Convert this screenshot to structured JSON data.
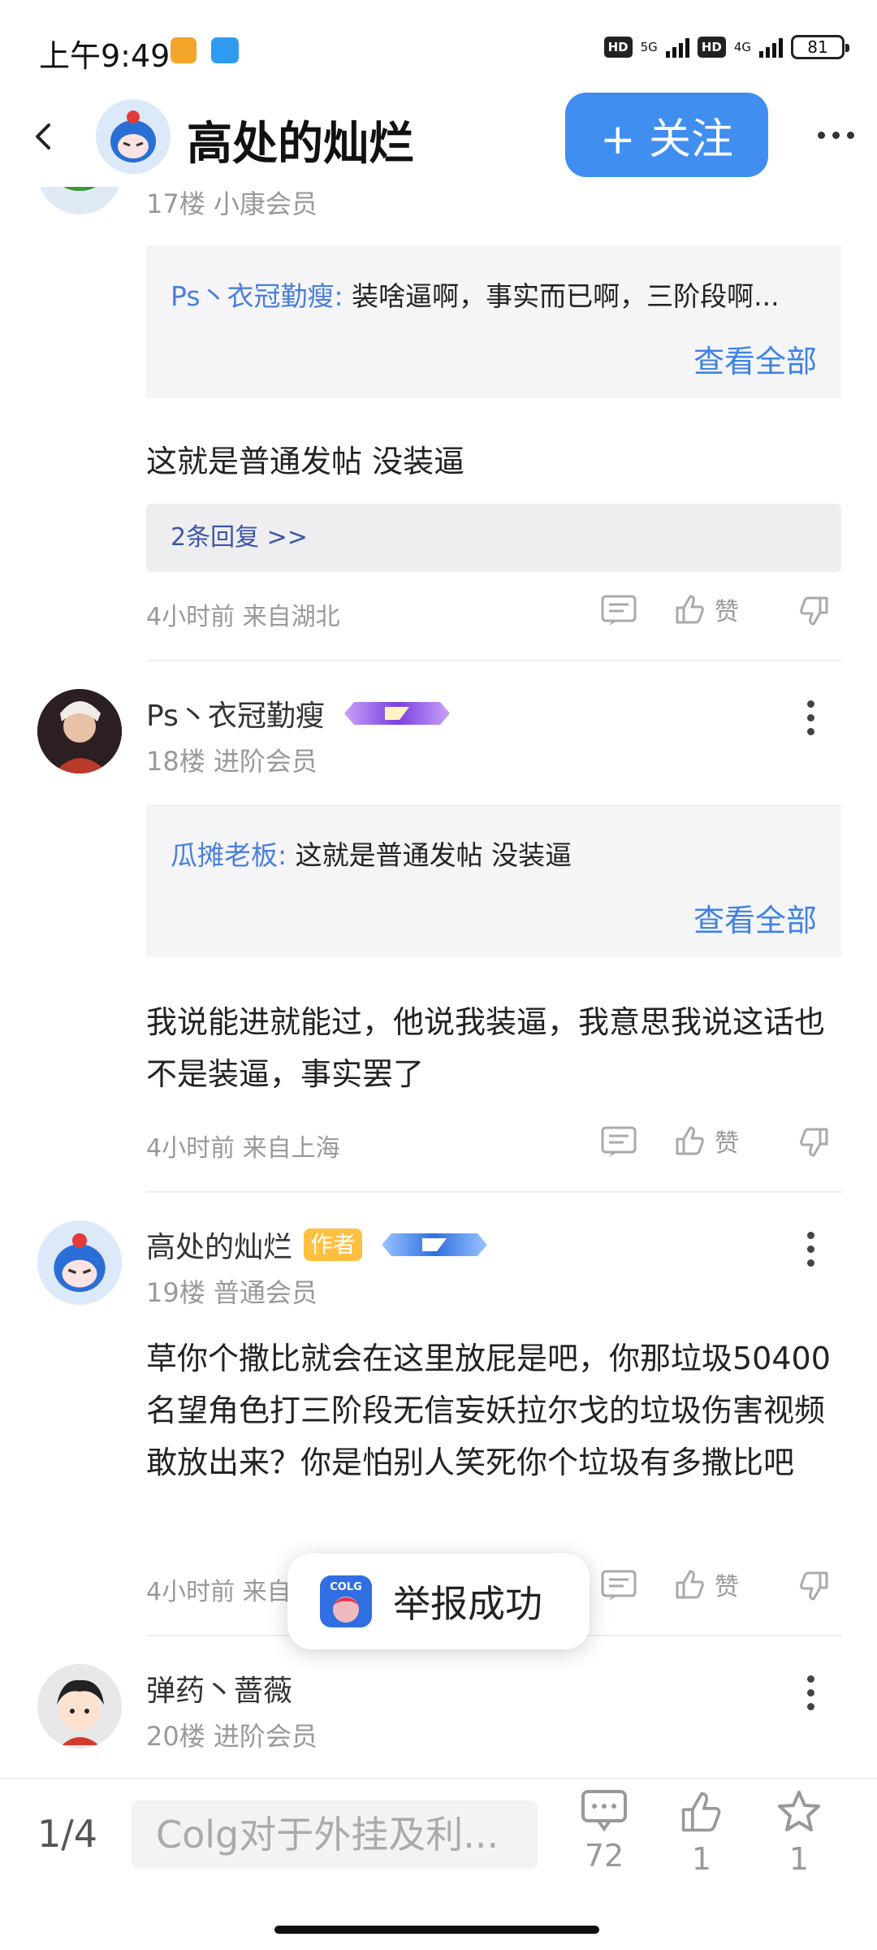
{
  "status_bar": {
    "time": "上午9:49",
    "hd1": "HD",
    "net1": "5G",
    "hd2": "HD",
    "net2": "4G",
    "battery": "81"
  },
  "header": {
    "title": "高处的灿烂",
    "follow_label": "+ 关注"
  },
  "floors": [
    {
      "meta": "17楼 小康会员",
      "quote_user": "Ps丶衣冠勤瘦:",
      "quote_text": " 装啥逼啊，事实而已啊，三阶段啊...",
      "quote_more": "查看全部",
      "body": "这就是普通发帖 没装逼",
      "replies": "2条回复 >>",
      "time_loc": "4小时前 来自湖北",
      "like_label": "赞"
    },
    {
      "username": "Ps丶衣冠勤瘦",
      "meta": "18楼 进阶会员",
      "quote_user": "瓜摊老板:",
      "quote_text": " 这就是普通发帖 没装逼",
      "quote_more": "查看全部",
      "body": "我说能进就能过，他说我装逼，我意思我说这话也不是装逼，事实罢了",
      "time_loc": "4小时前 来自上海",
      "like_label": "赞"
    },
    {
      "username": "高处的灿烂",
      "author_badge": "作者",
      "meta": "19楼 普通会员",
      "body": "草你个撒比就会在这里放屁是吧，你那垃圾50400名望角色打三阶段无信妄妖拉尔戈的垃圾伤害视频敢放出来？你是怕别人笑死你个垃圾有多撒比吧",
      "time_loc": "4小时前 来自",
      "like_label": "赞"
    },
    {
      "username": "弹药丶蔷薇",
      "meta": "20楼 进阶会员"
    }
  ],
  "toast": {
    "text": "举报成功",
    "app_icon_text": "COLG"
  },
  "bottom_bar": {
    "page_indicator": "1/4",
    "input_placeholder": "Colg对于外挂及利...",
    "comment_count": "72",
    "like_count": "1",
    "star_count": "1"
  },
  "colors": {
    "accent": "#3f8ef0",
    "link": "#3f83e4",
    "author_badge": "#ffbf3f"
  },
  "icons": [
    "back-icon",
    "more-horizontal-icon",
    "more-vertical-icon",
    "comment-icon",
    "thumbs-up-icon",
    "thumbs-down-icon",
    "star-icon"
  ]
}
